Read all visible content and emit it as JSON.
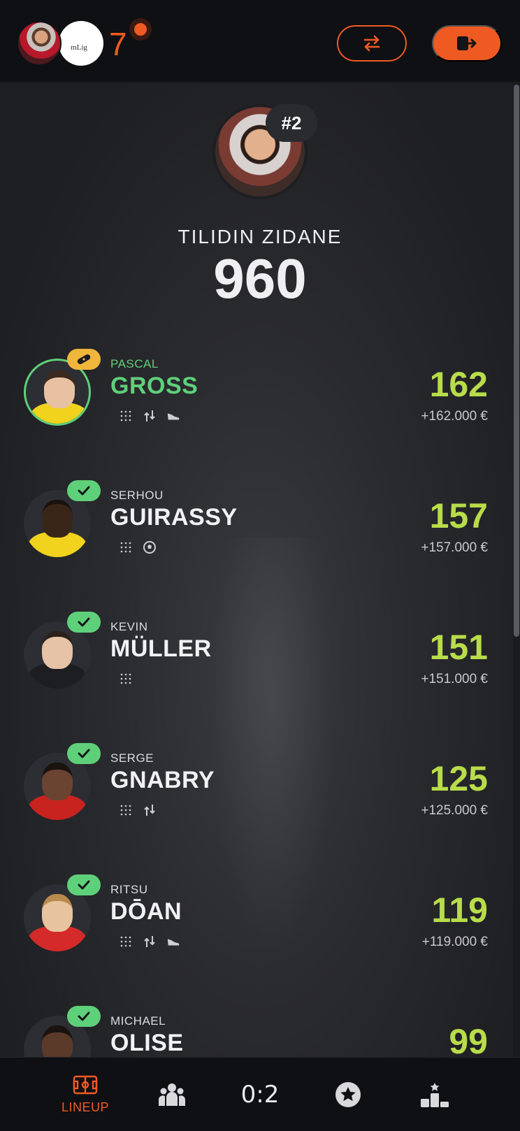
{
  "header": {
    "league_logo_text": "mLig",
    "rank": "7",
    "swap_icon": "swap-icon",
    "exit_icon": "logout-icon"
  },
  "profile": {
    "rank_label": "#2",
    "name": "TILIDIN ZIDANE",
    "score": "960"
  },
  "players": [
    {
      "first": "PASCAL",
      "last": "GROSS",
      "points": "162",
      "money": "+162.000 €",
      "status": "injury",
      "stats": [
        "dots-icon",
        "substitution-icon",
        "boot-icon"
      ]
    },
    {
      "first": "SERHOU",
      "last": "GUIRASSY",
      "points": "157",
      "money": "+157.000 €",
      "status": "ok",
      "stats": [
        "dots-icon",
        "ball-icon"
      ]
    },
    {
      "first": "KEVIN",
      "last": "MÜLLER",
      "points": "151",
      "money": "+151.000 €",
      "status": "ok",
      "stats": [
        "dots-icon"
      ]
    },
    {
      "first": "SERGE",
      "last": "GNABRY",
      "points": "125",
      "money": "+125.000 €",
      "status": "ok",
      "stats": [
        "dots-icon",
        "substitution-icon"
      ]
    },
    {
      "first": "RITSU",
      "last": "DŌAN",
      "points": "119",
      "money": "+119.000 €",
      "status": "ok",
      "stats": [
        "dots-icon",
        "substitution-icon",
        "boot-icon"
      ]
    },
    {
      "first": "MICHAEL",
      "last": "OLISE",
      "points": "99",
      "money": "",
      "status": "ok",
      "stats": []
    }
  ],
  "nav": {
    "lineup_label": "LINEUP",
    "score": "0:2"
  },
  "colors": {
    "accent": "#ef5a23",
    "points": "#b8dc4a",
    "ok": "#5fd07a",
    "injury": "#f0b63b"
  }
}
